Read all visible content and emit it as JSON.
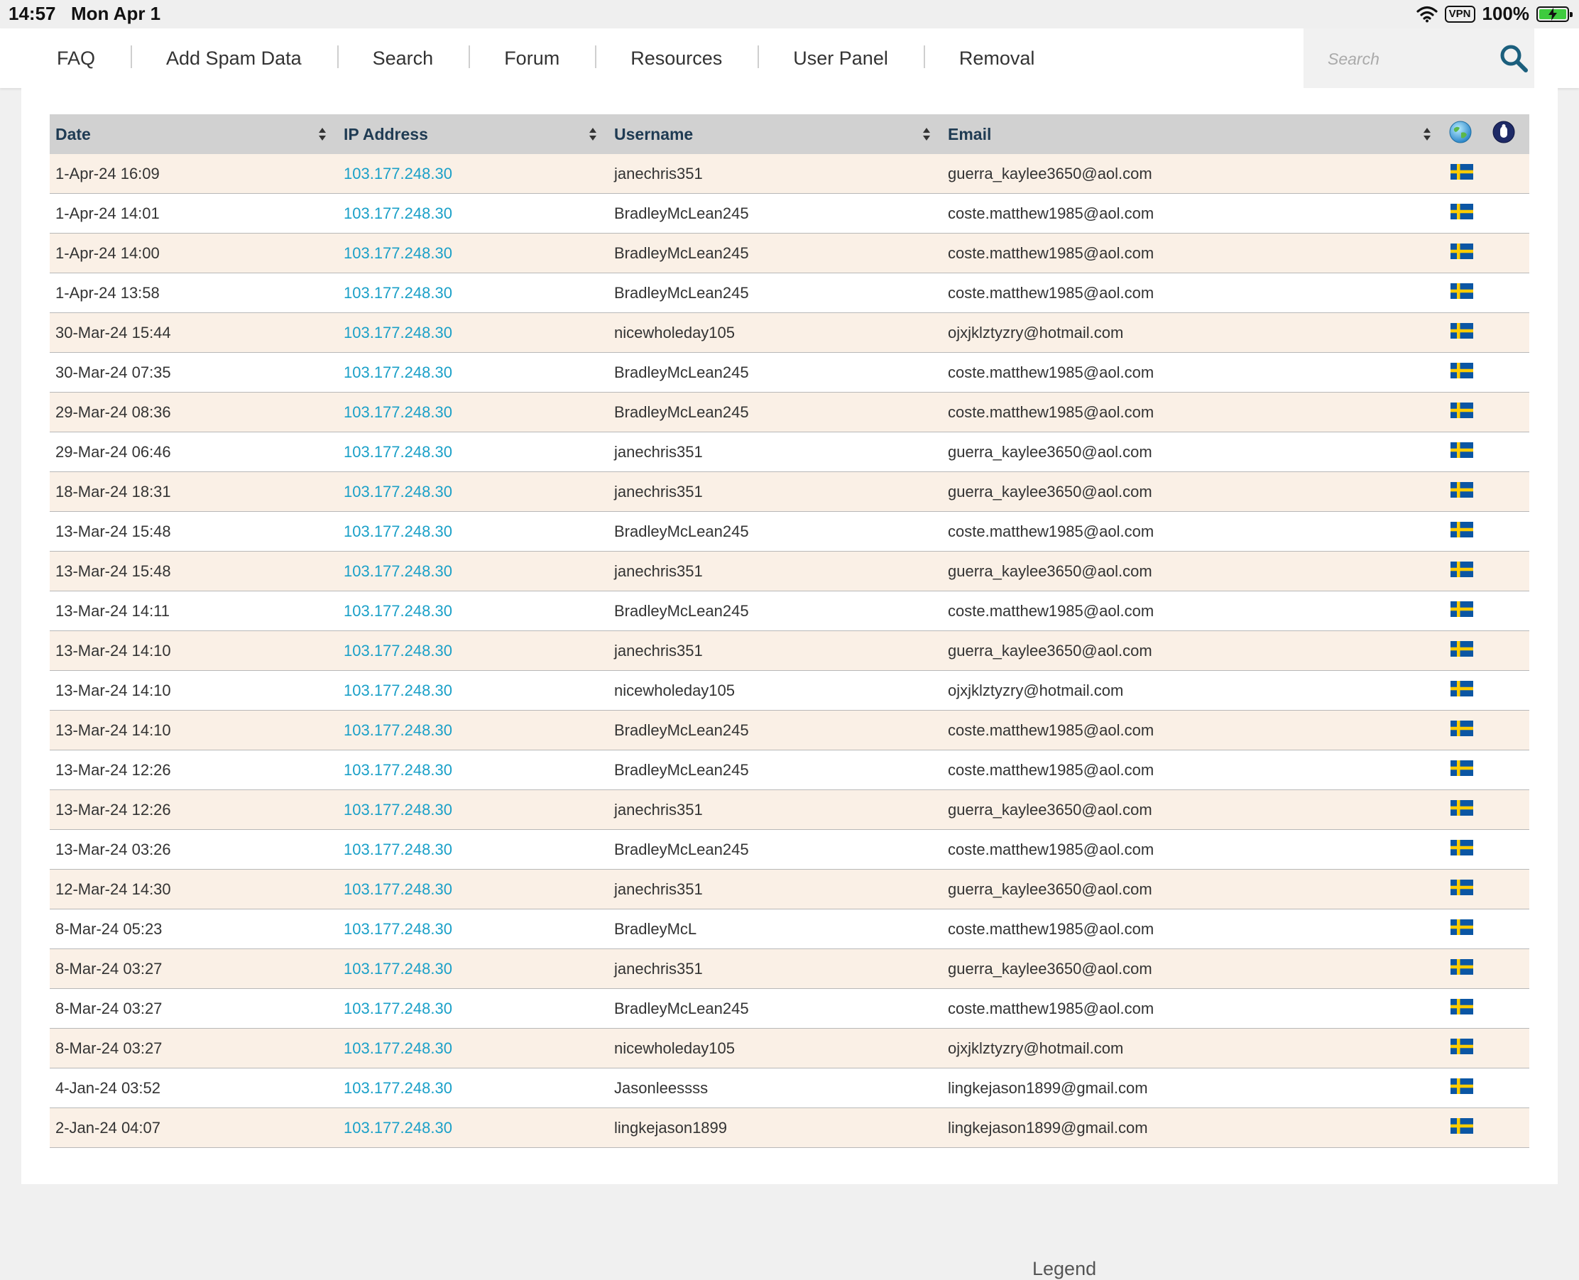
{
  "status_bar": {
    "time": "14:57",
    "date": "Mon Apr 1",
    "vpn": "VPN",
    "battery": "100%",
    "battery_level": 1.0
  },
  "nav": {
    "items": [
      "FAQ",
      "Add Spam Data",
      "Search",
      "Forum",
      "Resources",
      "User Panel",
      "Removal"
    ],
    "search_placeholder": "Search"
  },
  "table": {
    "headers": {
      "date": "Date",
      "ip": "IP Address",
      "username": "Username",
      "email": "Email"
    },
    "icons": {
      "globe": "globe-icon",
      "visit": "hand-icon",
      "country_flag": "sweden-flag-icon"
    },
    "rows": [
      {
        "date": "1-Apr-24 16:09",
        "ip": "103.177.248.30",
        "username": "janechris351",
        "email": "guerra_kaylee3650@aol.com"
      },
      {
        "date": "1-Apr-24 14:01",
        "ip": "103.177.248.30",
        "username": "BradleyMcLean245",
        "email": "coste.matthew1985@aol.com"
      },
      {
        "date": "1-Apr-24 14:00",
        "ip": "103.177.248.30",
        "username": "BradleyMcLean245",
        "email": "coste.matthew1985@aol.com"
      },
      {
        "date": "1-Apr-24 13:58",
        "ip": "103.177.248.30",
        "username": "BradleyMcLean245",
        "email": "coste.matthew1985@aol.com"
      },
      {
        "date": "30-Mar-24 15:44",
        "ip": "103.177.248.30",
        "username": "nicewholeday105",
        "email": "ojxjklztyzry@hotmail.com"
      },
      {
        "date": "30-Mar-24 07:35",
        "ip": "103.177.248.30",
        "username": "BradleyMcLean245",
        "email": "coste.matthew1985@aol.com"
      },
      {
        "date": "29-Mar-24 08:36",
        "ip": "103.177.248.30",
        "username": "BradleyMcLean245",
        "email": "coste.matthew1985@aol.com"
      },
      {
        "date": "29-Mar-24 06:46",
        "ip": "103.177.248.30",
        "username": "janechris351",
        "email": "guerra_kaylee3650@aol.com"
      },
      {
        "date": "18-Mar-24 18:31",
        "ip": "103.177.248.30",
        "username": "janechris351",
        "email": "guerra_kaylee3650@aol.com"
      },
      {
        "date": "13-Mar-24 15:48",
        "ip": "103.177.248.30",
        "username": "BradleyMcLean245",
        "email": "coste.matthew1985@aol.com"
      },
      {
        "date": "13-Mar-24 15:48",
        "ip": "103.177.248.30",
        "username": "janechris351",
        "email": "guerra_kaylee3650@aol.com"
      },
      {
        "date": "13-Mar-24 14:11",
        "ip": "103.177.248.30",
        "username": "BradleyMcLean245",
        "email": "coste.matthew1985@aol.com"
      },
      {
        "date": "13-Mar-24 14:10",
        "ip": "103.177.248.30",
        "username": "janechris351",
        "email": "guerra_kaylee3650@aol.com"
      },
      {
        "date": "13-Mar-24 14:10",
        "ip": "103.177.248.30",
        "username": "nicewholeday105",
        "email": "ojxjklztyzry@hotmail.com"
      },
      {
        "date": "13-Mar-24 14:10",
        "ip": "103.177.248.30",
        "username": "BradleyMcLean245",
        "email": "coste.matthew1985@aol.com"
      },
      {
        "date": "13-Mar-24 12:26",
        "ip": "103.177.248.30",
        "username": "BradleyMcLean245",
        "email": "coste.matthew1985@aol.com"
      },
      {
        "date": "13-Mar-24 12:26",
        "ip": "103.177.248.30",
        "username": "janechris351",
        "email": "guerra_kaylee3650@aol.com"
      },
      {
        "date": "13-Mar-24 03:26",
        "ip": "103.177.248.30",
        "username": "BradleyMcLean245",
        "email": "coste.matthew1985@aol.com"
      },
      {
        "date": "12-Mar-24 14:30",
        "ip": "103.177.248.30",
        "username": "janechris351",
        "email": "guerra_kaylee3650@aol.com"
      },
      {
        "date": "8-Mar-24 05:23",
        "ip": "103.177.248.30",
        "username": "BradleyMcL",
        "email": "coste.matthew1985@aol.com"
      },
      {
        "date": "8-Mar-24 03:27",
        "ip": "103.177.248.30",
        "username": "janechris351",
        "email": "guerra_kaylee3650@aol.com"
      },
      {
        "date": "8-Mar-24 03:27",
        "ip": "103.177.248.30",
        "username": "BradleyMcLean245",
        "email": "coste.matthew1985@aol.com"
      },
      {
        "date": "8-Mar-24 03:27",
        "ip": "103.177.248.30",
        "username": "nicewholeday105",
        "email": "ojxjklztyzry@hotmail.com"
      },
      {
        "date": "4-Jan-24 03:52",
        "ip": "103.177.248.30",
        "username": "Jasonleessss",
        "email": "lingkejason1899@gmail.com"
      },
      {
        "date": "2-Jan-24 04:07",
        "ip": "103.177.248.30",
        "username": "lingkejason1899",
        "email": "lingkejason1899@gmail.com"
      }
    ]
  },
  "legend": {
    "title": "Legend"
  },
  "colors": {
    "nav_text": "#333333",
    "header_bg": "#d1d1d1",
    "header_text": "#1f3b53",
    "row_alt_bg": "#faf0e6",
    "ip_link": "#1aa0c8",
    "search_icon": "#1b5f7d"
  }
}
